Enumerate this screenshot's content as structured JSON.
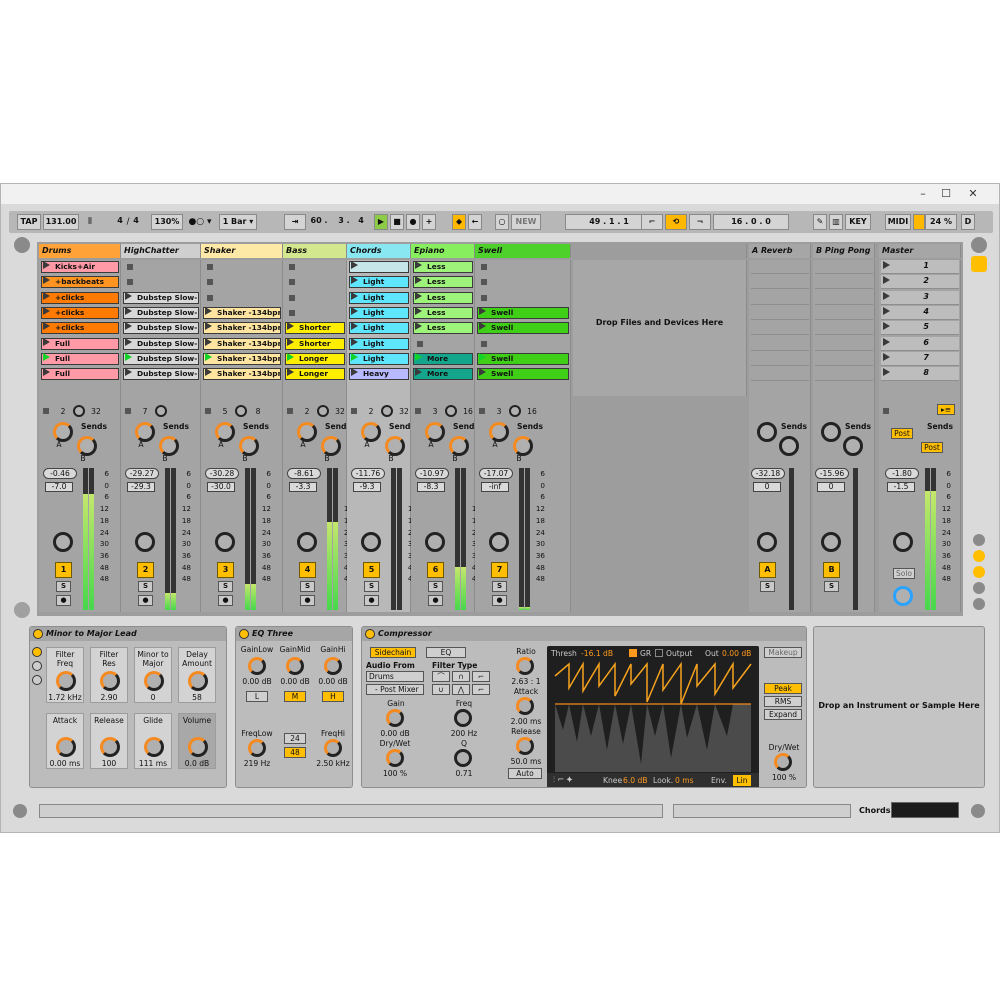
{
  "window": {
    "minimize": "–",
    "maximize": "☐",
    "close": "✕"
  },
  "control_bar": {
    "tap": "TAP",
    "tempo": "131.00",
    "sig_num": "4",
    "sig_div": "/",
    "sig_den": "4",
    "groove": "130%",
    "quant": "1 Bar ▾",
    "pos": [
      "60 .",
      "3 .",
      "4"
    ],
    "new_label": "NEW",
    "loop_pos": [
      "49 .",
      "1 .",
      "1"
    ],
    "loop_len": [
      "16 .",
      "0 .",
      "0"
    ],
    "key_label": "KEY",
    "midi_label": "MIDI",
    "cpu": "24 %",
    "disk": "D"
  },
  "tracks": [
    {
      "name": "Drums",
      "color": "#ffa238",
      "clips": [
        [
          "Kicks+Air",
          "#ff9aa6",
          false
        ],
        [
          "+backbeats",
          "#ff9420",
          false
        ],
        [
          "+clicks",
          "#ff7a00",
          false
        ],
        [
          "+clicks",
          "#ff7a00",
          false
        ],
        [
          "+clicks",
          "#ff7a00",
          false
        ],
        [
          "Full",
          "#ff9aa6",
          false
        ],
        [
          "Full",
          "#ff9aa6",
          true
        ],
        [
          "Full",
          "#ff9aa6",
          false
        ]
      ],
      "num": "2",
      "num2": "32",
      "vol": "-0.46",
      "pan": "-7.0",
      "btn": "1",
      "meter": 0.82
    },
    {
      "name": "HighChatter",
      "color": "#cfcfcf",
      "clips": [
        null,
        null,
        [
          "Dubstep Slow-1",
          "#d8d8d8",
          false
        ],
        [
          "Dubstep Slow-1",
          "#d8d8d8",
          false
        ],
        [
          "Dubstep Slow-1",
          "#d8d8d8",
          false
        ],
        [
          "Dubstep Slow-1",
          "#d8d8d8",
          false
        ],
        [
          "Dubstep Slow-1",
          "#d8d8d8",
          true
        ],
        [
          "Dubstep Slow-1",
          "#d8d8d8",
          false
        ]
      ],
      "num": "7",
      "num2": "",
      "vol": "-29.27",
      "pan": "-29.3",
      "btn": "2",
      "meter": 0.12
    },
    {
      "name": "Shaker",
      "color": "#ffe9a6",
      "clips": [
        null,
        null,
        null,
        [
          "Shaker -134bpm",
          "#ffe5a0",
          false
        ],
        [
          "Shaker -134bpm",
          "#ffe5a0",
          false
        ],
        [
          "Shaker -134bpm",
          "#ffe5a0",
          false
        ],
        [
          "Shaker -134bpm",
          "#ffe5a0",
          true
        ],
        [
          "Shaker -134bpm",
          "#ffe5a0",
          false
        ]
      ],
      "num": "5",
      "num2": "8",
      "vol": "-30.28",
      "pan": "-30.0",
      "btn": "3",
      "meter": 0.18
    },
    {
      "name": "Bass",
      "color": "#d3e78f",
      "clips": [
        null,
        null,
        null,
        null,
        [
          "Shorter",
          "#ffee00",
          false
        ],
        [
          "Shorter",
          "#ffee00",
          false
        ],
        [
          "Longer",
          "#ffee00",
          true
        ],
        [
          "Longer",
          "#ffee00",
          false
        ]
      ],
      "num": "2",
      "num2": "32",
      "vol": "-8.61",
      "pan": "-3.3",
      "btn": "4",
      "meter": 0.62
    },
    {
      "name": "Chords",
      "color": "#88e7f1",
      "clips": [
        [
          "",
          "#c6e5e8",
          false
        ],
        [
          "Light",
          "#5fe6ff",
          false
        ],
        [
          "Light",
          "#5fe6ff",
          false
        ],
        [
          "Light",
          "#5fe6ff",
          false
        ],
        [
          "Light",
          "#5fe6ff",
          false
        ],
        [
          "Light",
          "#5fe6ff",
          false
        ],
        [
          "Light",
          "#5fe6ff",
          true
        ],
        [
          "Heavy",
          "#b9b9ff",
          false
        ]
      ],
      "num": "2",
      "num2": "32",
      "vol": "-11.76",
      "pan": "-9.3",
      "btn": "5",
      "meter": 0.0
    },
    {
      "name": "Epiano",
      "color": "#87ef5d",
      "clips": [
        [
          "Less",
          "#9ef47a",
          false
        ],
        [
          "Less",
          "#9ef47a",
          false
        ],
        [
          "Less",
          "#9ef47a",
          false
        ],
        [
          "Less",
          "#9ef47a",
          false
        ],
        [
          "Less",
          "#9ef47a",
          false
        ],
        null,
        [
          "More",
          "#14a68c",
          true
        ],
        [
          "More",
          "#14a68c",
          false
        ]
      ],
      "num": "3",
      "num2": "16",
      "vol": "-10.97",
      "pan": "-8.3",
      "btn": "6",
      "meter": 0.3
    },
    {
      "name": "Swell",
      "color": "#4fd12c",
      "clips": [
        null,
        null,
        null,
        [
          "Swell",
          "#3fcf16",
          false
        ],
        [
          "Swell",
          "#3fcf16",
          false
        ],
        null,
        [
          "Swell",
          "#3fcf16",
          true
        ],
        [
          "Swell",
          "#3fcf16",
          false
        ]
      ],
      "num": "3",
      "num2": "16",
      "vol": "-17.07",
      "pan": "-inf",
      "btn": "7",
      "meter": 0.02
    }
  ],
  "drop_text": "Drop Files and Devices Here",
  "returns": [
    {
      "name": "A Reverb",
      "vol": "-32.18",
      "pan": "0",
      "btn": "A"
    },
    {
      "name": "B Ping Pong",
      "vol": "-15.96",
      "pan": "0",
      "btn": "B"
    }
  ],
  "master": {
    "name": "Master",
    "scenes": [
      "1",
      "2",
      "3",
      "4",
      "5",
      "6",
      "7",
      "8"
    ],
    "vol": "-1.80",
    "pan": "-1.5",
    "post": "Post",
    "solo": "Solo"
  },
  "sends_label": "Sends",
  "send_a": "A",
  "send_b": "B",
  "solo_s": "S",
  "scale": [
    "6",
    "0",
    "6",
    "12",
    "18",
    "24",
    "30",
    "36",
    "48",
    "48"
  ],
  "devices": {
    "synth": {
      "title": "Minor to Major Lead",
      "macros": [
        {
          "l1": "Filter",
          "l2": "Freq",
          "v": "1.72 kHz"
        },
        {
          "l1": "Filter",
          "l2": "Res",
          "v": "2.90"
        },
        {
          "l1": "Minor to",
          "l2": "Major",
          "v": "0"
        },
        {
          "l1": "Delay",
          "l2": "Amount",
          "v": "58"
        },
        {
          "l1": "Attack",
          "l2": "",
          "v": "0.00 ms"
        },
        {
          "l1": "Release",
          "l2": "",
          "v": "100"
        },
        {
          "l1": "Glide",
          "l2": "",
          "v": "111 ms"
        },
        {
          "l1": "Volume",
          "l2": "",
          "v": "0.0 dB"
        }
      ]
    },
    "eq": {
      "title": "EQ Three",
      "gl": "GainLow",
      "gm": "GainMid",
      "gh": "GainHi",
      "v1": "0.00 dB",
      "v2": "0.00 dB",
      "v3": "0.00 dB",
      "l": "L",
      "m": "M",
      "h": "H",
      "fl": "FreqLow",
      "fh": "FreqHi",
      "flv": "219 Hz",
      "fhv": "2.50 kHz",
      "s24": "24",
      "s48": "48"
    },
    "comp": {
      "title": "Compressor",
      "sidechain": "Sidechain",
      "eq": "EQ",
      "audio_from": "Audio From",
      "src": "Drums",
      "post": "- Post Mixer",
      "gain": "Gain",
      "gainv": "0.00 dB",
      "drywet": "Dry/Wet",
      "dwv": "100 %",
      "ftype": "Filter Type",
      "freq": "Freq",
      "freqv": "200 Hz",
      "q": "Q",
      "qv": "0.71",
      "ratio": "Ratio",
      "ratiov": "2.63 : 1",
      "attack": "Attack",
      "attackv": "2.00 ms",
      "release": "Release",
      "releasev": "50.0 ms",
      "auto": "Auto",
      "thresh": "Thresh",
      "threshv": "-16.1 dB",
      "gr": "GR",
      "output": "Output",
      "out": "Out",
      "outv": "0.00 dB",
      "knee": "Knee",
      "kneev": "6.0 dB",
      "look": "Look.",
      "lookv": "0 ms",
      "env": "Env.",
      "lin": "Lin",
      "makeup": "Makeup",
      "peak": "Peak",
      "rms": "RMS",
      "expand": "Expand",
      "dw2": "Dry/Wet",
      "dw2v": "100 %"
    },
    "drop_inst": "Drop an Instrument or Sample Here"
  },
  "status": {
    "track": "Chords"
  }
}
